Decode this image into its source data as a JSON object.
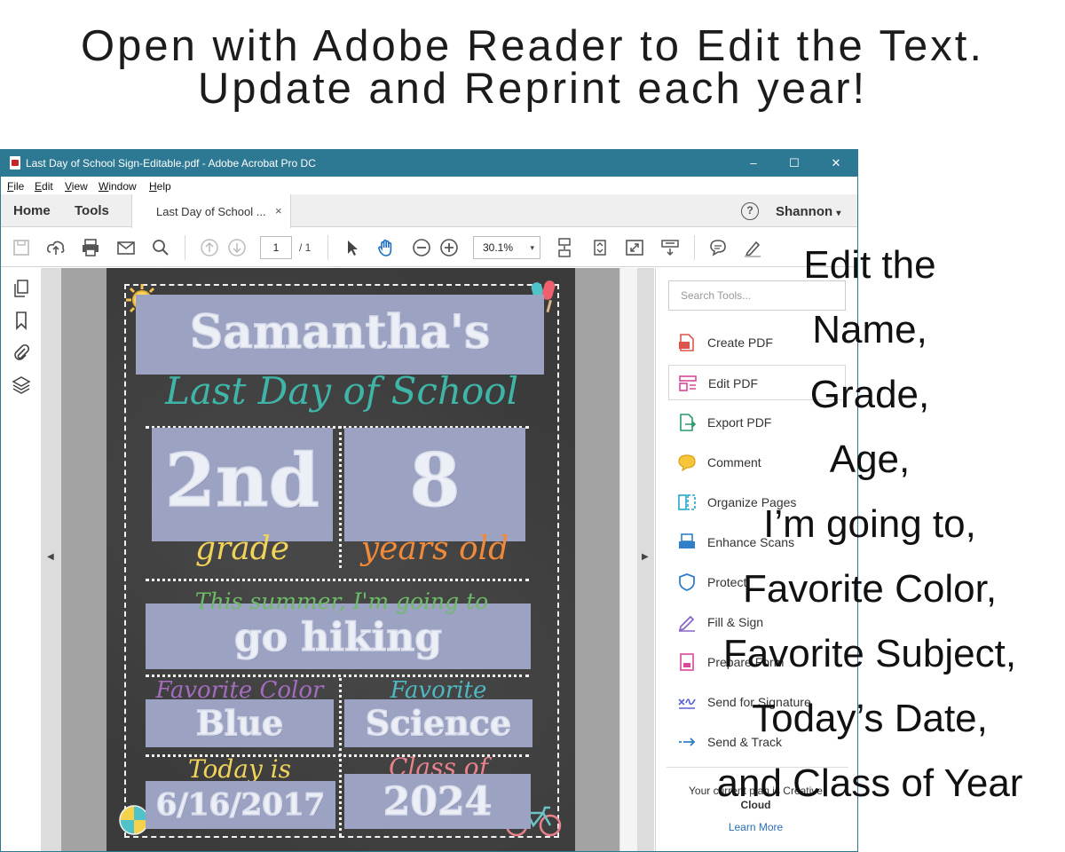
{
  "headline": {
    "line1": "Open with Adobe Reader to Edit the Text.",
    "line2": "Update and Reprint each year!"
  },
  "window": {
    "title": "Last Day of School Sign-Editable.pdf - Adobe Acrobat Pro DC",
    "controls": {
      "minimize": "–",
      "maximize": "☐",
      "close": "✕"
    },
    "menu": [
      "File",
      "Edit",
      "View",
      "Window",
      "Help"
    ],
    "tabs": {
      "home": "Home",
      "tools": "Tools",
      "document": "Last Day of School ...",
      "close": "×"
    },
    "help": "?",
    "user": "Shannon",
    "user_caret": "▾",
    "toolbar": {
      "page_current": "1",
      "page_total": "/ 1",
      "zoom": "30.1%",
      "zoom_caret": "▾"
    },
    "nav_arrows": {
      "left": "◀",
      "right": "▶"
    }
  },
  "sign": {
    "name": "Samantha's",
    "subtitle": "Last Day of School",
    "grade_value": "2nd",
    "grade_label": "grade",
    "age_value": "8",
    "age_label": "years old",
    "summer_label": "This summer, I'm going to",
    "summer_value": "go hiking",
    "color_label": "Favorite Color",
    "color_value": "Blue",
    "subject_label": "Favorite Subject",
    "subject_value": "Science",
    "date_label": "Today is",
    "date_value": "6/16/2017",
    "class_label": "Class of",
    "class_value": "2024"
  },
  "tools_pane": {
    "search_placeholder": "Search Tools...",
    "items": [
      {
        "label": "Create PDF",
        "icon": "create-pdf-icon"
      },
      {
        "label": "Edit PDF",
        "icon": "edit-pdf-icon"
      },
      {
        "label": "Export PDF",
        "icon": "export-pdf-icon"
      },
      {
        "label": "Comment",
        "icon": "comment-icon"
      },
      {
        "label": "Organize Pages",
        "icon": "organize-pages-icon"
      },
      {
        "label": "Enhance Scans",
        "icon": "enhance-scans-icon"
      },
      {
        "label": "Protect",
        "icon": "protect-icon"
      },
      {
        "label": "Fill & Sign",
        "icon": "fill-sign-icon"
      },
      {
        "label": "Prepare Form",
        "icon": "prepare-form-icon"
      },
      {
        "label": "Send for Signature",
        "icon": "send-signature-icon"
      },
      {
        "label": "Send & Track",
        "icon": "send-track-icon"
      }
    ],
    "plan_line1": "Your current plan is Creative",
    "plan_line2": "Cloud",
    "learn_more": "Learn More"
  },
  "overlay_lines": [
    "Edit the",
    "Name,",
    "Grade,",
    "Age,",
    "I’m going to,",
    "Favorite Color,",
    "Favorite Subject,",
    "Today’s Date,",
    "and Class of Year"
  ],
  "colors": {
    "titlebar": "#2d7892",
    "chalkboard": "#3b3b3b",
    "field": "#9ca2c2",
    "subtitle": "#3fb5a8",
    "grade_label": "#f1d35a",
    "age_label": "#ef8a3a",
    "summer_label": "#6dbb66",
    "color_label": "#a36cbf",
    "subject_label": "#4fb7c2",
    "date_label": "#f1d35a",
    "class_label": "#e9828c"
  }
}
